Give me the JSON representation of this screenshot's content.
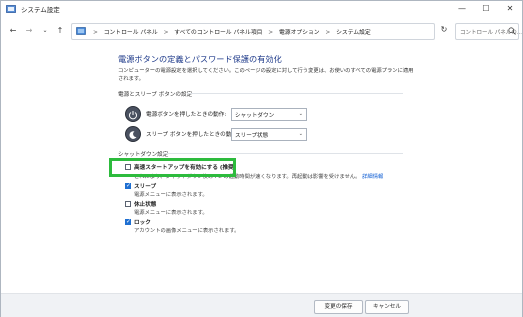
{
  "window": {
    "title": "システム設定",
    "controls": {
      "minimize": "—",
      "maximize": "☐",
      "close": "✕"
    }
  },
  "nav": {
    "back": "←",
    "forward": "→",
    "recent": "⌄",
    "up": "↑"
  },
  "address": {
    "crumbs": [
      "コントロール パネル",
      "すべてのコントロール パネル項目",
      "電源オプション",
      "システム設定"
    ],
    "sep": ">",
    "dropdown": "⌄",
    "refresh": "↻"
  },
  "search": {
    "placeholder": "コントロール パネルの..."
  },
  "page": {
    "title": "電源ボタンの定義とパスワード保護の有効化",
    "description": "コンピューターの電源設定を選択してください。このページの設定に対して行う変更は、お使いのすべての電源プランに適用されます。",
    "power_section_title": "電源とスリープ ボタンの設定",
    "rows": [
      {
        "label": "電源ボタンを押したときの動作:",
        "value": "シャットダウン"
      },
      {
        "label": "スリープ ボタンを押したときの動作:",
        "value": "スリープ状態"
      }
    ],
    "shutdown_section_title": "シャットダウン設定",
    "options": [
      {
        "label": "高速スタートアップを有効にする (推奨)",
        "sub": "これにより、シャットダウン後の PC の起動時間が速くなります。再起動は影響を受けません。",
        "link": "詳細情報",
        "checked": false
      },
      {
        "label": "スリープ",
        "sub": "電源メニューに表示されます。",
        "checked": true
      },
      {
        "label": "休止状態",
        "sub": "電源メニューに表示されます。",
        "checked": false
      },
      {
        "label": "ロック",
        "sub": "アカウントの画像メニューに表示されます。",
        "checked": true
      }
    ]
  },
  "footer": {
    "save_label": "変更の保存",
    "cancel_label": "キャンセル"
  },
  "colors": {
    "highlight": "#2dbb3d",
    "title": "#1e3a8a",
    "link": "#0b5bd3",
    "checkbox": "#1f6fd1"
  }
}
